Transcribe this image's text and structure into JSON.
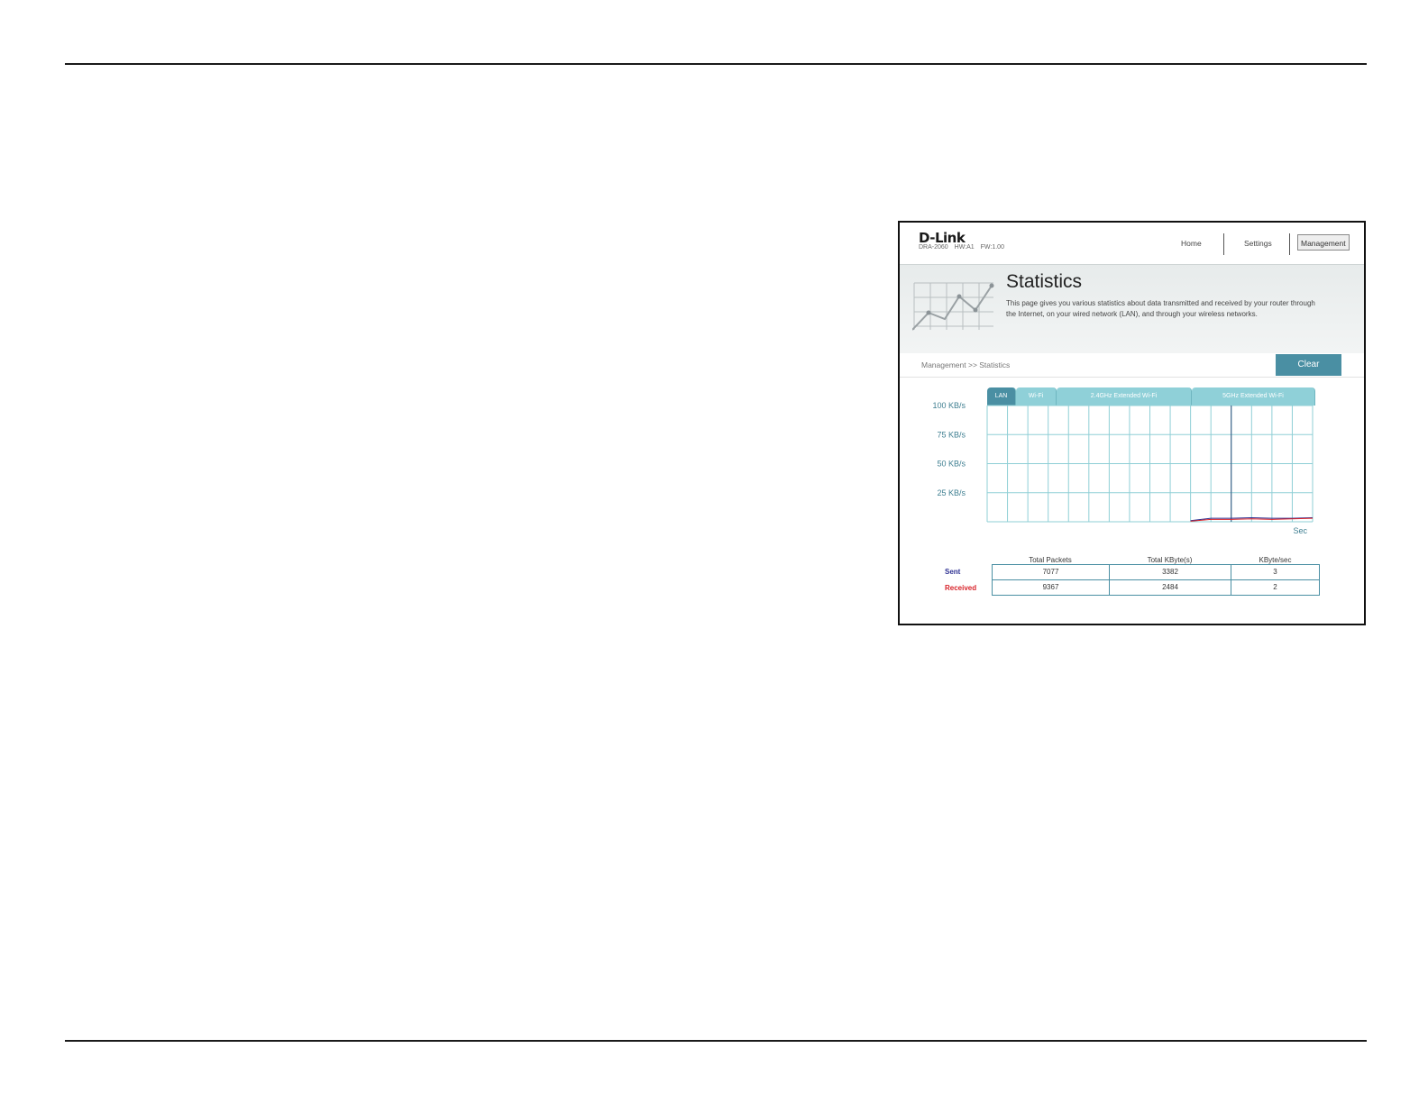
{
  "header": {
    "logo": "D-Link",
    "model": "DRA-2060",
    "hw": "HW:A1",
    "fw": "FW:1.00",
    "nav": {
      "home": "Home",
      "settings": "Settings",
      "management": "Management"
    }
  },
  "banner": {
    "title": "Statistics",
    "description": "This page gives you various statistics about data transmitted and received by your router through the Internet, on your wired network (LAN), and through your wireless networks."
  },
  "breadcrumb": "Management >> Statistics",
  "clear_label": "Clear",
  "tabs": [
    {
      "label": "LAN",
      "active": true
    },
    {
      "label": "Wi-Fi",
      "active": false
    },
    {
      "label": "2.4GHz Extended Wi-Fi",
      "active": false
    },
    {
      "label": "5GHz Extended Wi-Fi",
      "active": false
    }
  ],
  "chart_data": {
    "type": "line",
    "y_tick_labels": [
      "100 KB/s",
      "75 KB/s",
      "50 KB/s",
      "25 KB/s"
    ],
    "ylim": [
      0,
      100
    ],
    "xlabel": "Sec",
    "grid": true,
    "series": [
      {
        "color": "#2e3192",
        "values": [
          null,
          null,
          null,
          null,
          null,
          null,
          null,
          null,
          null,
          null,
          1,
          3,
          3,
          3.5,
          3,
          3,
          3.5
        ]
      },
      {
        "color": "#d8232a",
        "values": [
          null,
          null,
          null,
          null,
          null,
          null,
          null,
          null,
          null,
          null,
          0.5,
          2,
          2,
          2.5,
          2,
          2.5,
          3
        ]
      }
    ]
  },
  "stats": {
    "columns": [
      "Total Packets",
      "Total KByte(s)",
      "KByte/sec"
    ],
    "rows": [
      {
        "label": "Sent",
        "values": [
          "7077",
          "3382",
          "3"
        ]
      },
      {
        "label": "Received",
        "values": [
          "9367",
          "2484",
          "2"
        ]
      }
    ]
  }
}
